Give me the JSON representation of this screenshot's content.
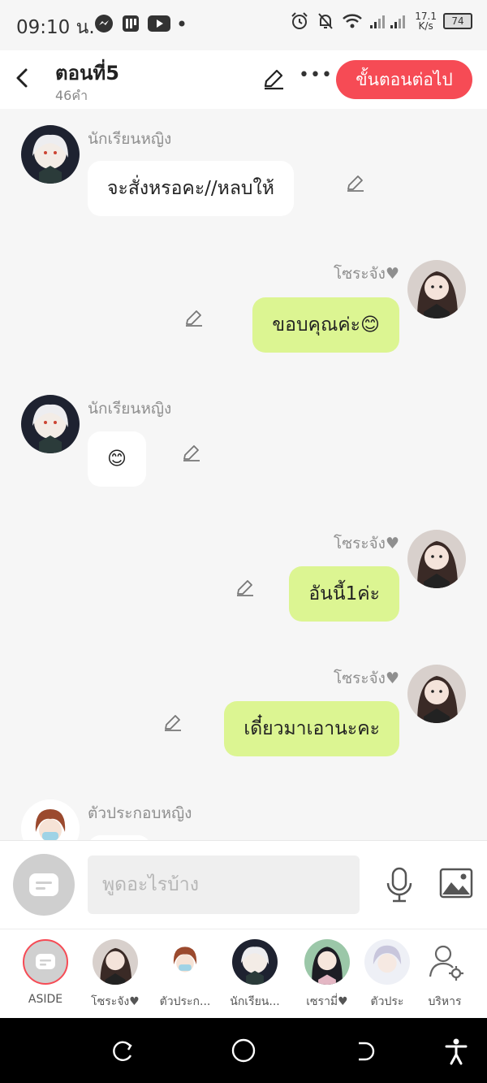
{
  "status": {
    "time": "09:10 น.",
    "net_speed_value": "17.1",
    "net_speed_unit": "K/s",
    "battery": "74"
  },
  "header": {
    "title": "ตอนที่5",
    "subtitle": "46คำ",
    "next_label": "ขั้นตอนต่อไป"
  },
  "messages": [
    {
      "side": "left",
      "name": "นักเรียนหญิง",
      "text": "จะสั่งหรอคะ//หลบให้"
    },
    {
      "side": "right",
      "name": "โซระจัง♥",
      "text": "ขอบคุณค่ะ😊"
    },
    {
      "side": "left",
      "name": "นักเรียนหญิง",
      "text": "😊"
    },
    {
      "side": "right",
      "name": "โซระจัง♥",
      "text": "อันนี้1ค่ะ"
    },
    {
      "side": "right",
      "name": "โซระจัง♥",
      "text": "เดี๋ยวมาเอานะคะ"
    },
    {
      "side": "left",
      "name": "ตัวประกอบหญิง",
      "text": ""
    }
  ],
  "input": {
    "placeholder": "พูดอะไรบ้าง"
  },
  "characters": [
    {
      "label": "ASIDE"
    },
    {
      "label": "โซระจัง♥"
    },
    {
      "label": "ตัวประก..."
    },
    {
      "label": "นักเรียน..."
    },
    {
      "label": "เซรามี่♥"
    },
    {
      "label": "ตัวประ"
    },
    {
      "label": "บริหาร"
    }
  ],
  "colors": {
    "accent": "#f64b55",
    "right_bubble": "#dcf592",
    "left_bubble": "#ffffff",
    "background": "#f6f6f6"
  }
}
